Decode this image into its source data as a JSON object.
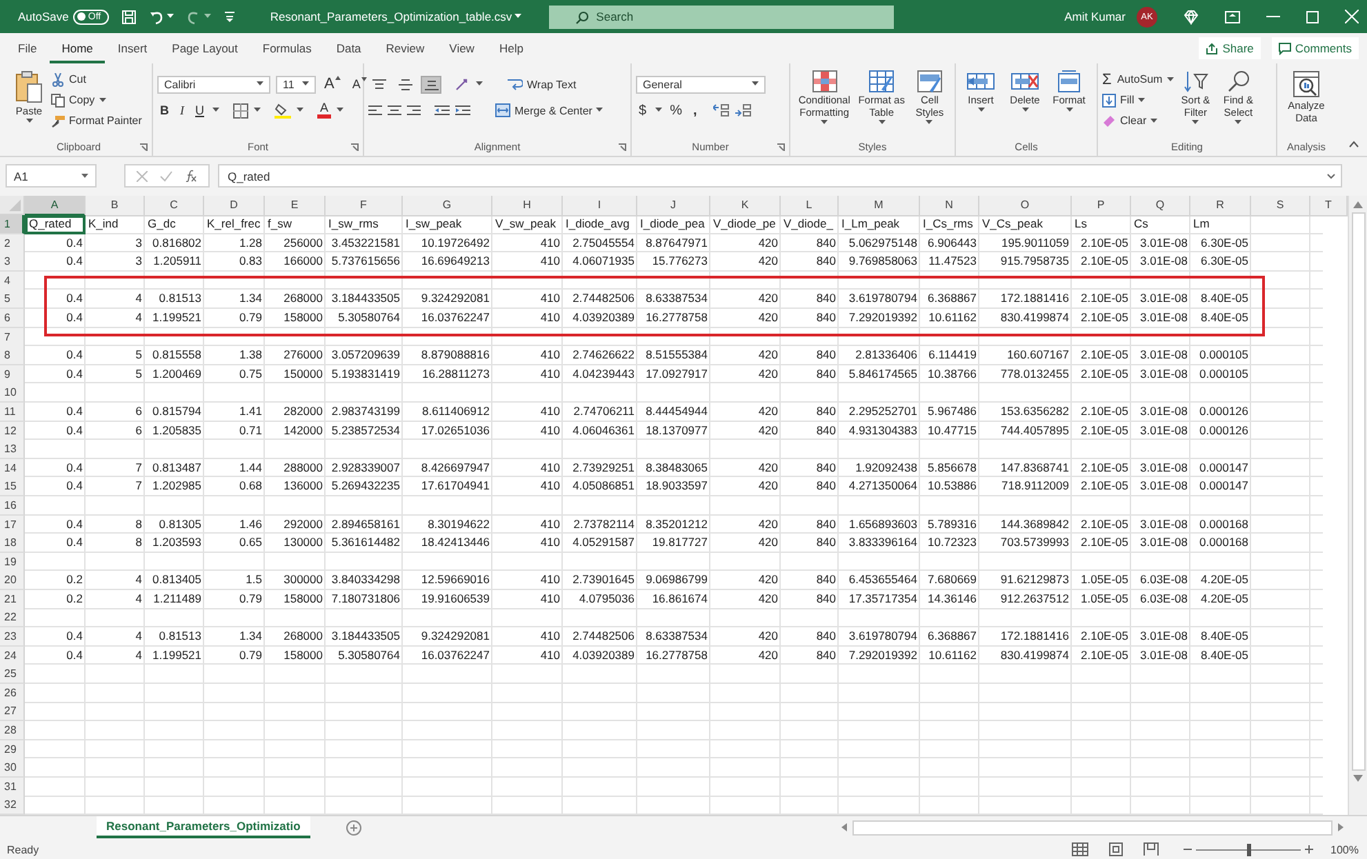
{
  "title_bar": {
    "autosave_label": "AutoSave",
    "autosave_state": "Off",
    "autosave_on": false,
    "file_name": "Resonant_Parameters_Optimization_table.csv",
    "search_placeholder": "Search",
    "user_name": "Amit Kumar",
    "user_initials": "AK"
  },
  "menu_tabs": [
    {
      "label": "File",
      "selected": false
    },
    {
      "label": "Home",
      "selected": true
    },
    {
      "label": "Insert",
      "selected": false
    },
    {
      "label": "Page Layout",
      "selected": false
    },
    {
      "label": "Formulas",
      "selected": false
    },
    {
      "label": "Data",
      "selected": false
    },
    {
      "label": "Review",
      "selected": false
    },
    {
      "label": "View",
      "selected": false
    },
    {
      "label": "Help",
      "selected": false
    }
  ],
  "share": "Share",
  "comments": "Comments",
  "ribbon": {
    "clipboard": {
      "label": "Clipboard",
      "paste": "Paste",
      "cut": "Cut",
      "copy": "Copy",
      "format_painter": "Format Painter"
    },
    "font": {
      "label": "Font",
      "font_name": "Calibri",
      "font_size": "11",
      "grow": "A",
      "shrink": "A",
      "bold": "B",
      "italic": "I",
      "underline": "U",
      "font_color_letter": "A"
    },
    "alignment": {
      "label": "Alignment",
      "vertical": [
        {
          "selected": false
        },
        {
          "selected": false
        },
        {
          "selected": true
        }
      ],
      "wrap_text": "Wrap Text",
      "merge_center": "Merge & Center"
    },
    "number": {
      "label": "Number",
      "format": "General",
      "currency": "$",
      "percent": "%",
      "comma": ","
    },
    "styles": {
      "label": "Styles",
      "conditional_formatting": "Conditional Formatting",
      "format_as_table": "Format as Table",
      "cell_styles": "Cell Styles"
    },
    "cells": {
      "label": "Cells",
      "insert": "Insert",
      "delete": "Delete",
      "format": "Format"
    },
    "editing": {
      "label": "Editing",
      "sum_symbol": "Σ",
      "autosum": "AutoSum",
      "fill": "Fill",
      "clear": "Clear",
      "sort_filter": "Sort & Filter",
      "find_select": "Find & Select"
    },
    "analysis": {
      "label": "Analysis",
      "analyze_data": "Analyze Data"
    }
  },
  "formula_bar": {
    "name_box": "A1",
    "formula": "Q_rated"
  },
  "sheet": {
    "columns": [
      {
        "letter": "A",
        "selected": true
      },
      {
        "letter": "B",
        "selected": false
      },
      {
        "letter": "C",
        "selected": false
      },
      {
        "letter": "D",
        "selected": false
      },
      {
        "letter": "E",
        "selected": false
      },
      {
        "letter": "F",
        "selected": false
      },
      {
        "letter": "G",
        "selected": false
      },
      {
        "letter": "H",
        "selected": false
      },
      {
        "letter": "I",
        "selected": false
      },
      {
        "letter": "J",
        "selected": false
      },
      {
        "letter": "K",
        "selected": false
      },
      {
        "letter": "L",
        "selected": false
      },
      {
        "letter": "M",
        "selected": false
      },
      {
        "letter": "N",
        "selected": false
      },
      {
        "letter": "O",
        "selected": false
      },
      {
        "letter": "P",
        "selected": false
      },
      {
        "letter": "Q",
        "selected": false
      },
      {
        "letter": "R",
        "selected": false
      },
      {
        "letter": "S",
        "selected": false
      },
      {
        "letter": "T",
        "selected": false
      }
    ],
    "header_row": {
      "number": "1",
      "selected": true,
      "cells": [
        "Q_rated",
        "K_ind",
        "G_dc",
        "K_rel_frec",
        "f_sw",
        "I_sw_rms",
        "I_sw_peak",
        "V_sw_peak",
        "I_diode_avg",
        "I_diode_pea",
        "V_diode_pe",
        "V_diode_",
        "I_Lm_peak",
        "I_Cs_rms",
        "V_Cs_peak",
        "Ls",
        "Cs",
        "Lm"
      ]
    },
    "rows": [
      {
        "number": "2",
        "selected": false,
        "cells": [
          "0.4",
          "3",
          "0.816802",
          "1.28",
          "256000",
          "3.453221581",
          "10.19726492",
          "410",
          "2.75045554",
          "8.87647971",
          "420",
          "840",
          "5.062975148",
          "6.906443",
          "195.9011059",
          "2.10E-05",
          "3.01E-08",
          "6.30E-05"
        ]
      },
      {
        "number": "3",
        "selected": false,
        "cells": [
          "0.4",
          "3",
          "1.205911",
          "0.83",
          "166000",
          "5.737615656",
          "16.69649213",
          "410",
          "4.06071935",
          "15.776273",
          "420",
          "840",
          "9.769858063",
          "11.47523",
          "915.7958735",
          "2.10E-05",
          "3.01E-08",
          "6.30E-05"
        ]
      },
      {
        "number": "4",
        "selected": false
      },
      {
        "number": "5",
        "selected": false,
        "cells": [
          "0.4",
          "4",
          "0.81513",
          "1.34",
          "268000",
          "3.184433505",
          "9.324292081",
          "410",
          "2.74482506",
          "8.63387534",
          "420",
          "840",
          "3.619780794",
          "6.368867",
          "172.1881416",
          "2.10E-05",
          "3.01E-08",
          "8.40E-05"
        ]
      },
      {
        "number": "6",
        "selected": false,
        "cells": [
          "0.4",
          "4",
          "1.199521",
          "0.79",
          "158000",
          "5.30580764",
          "16.03762247",
          "410",
          "4.03920389",
          "16.2778758",
          "420",
          "840",
          "7.292019392",
          "10.61162",
          "830.4199874",
          "2.10E-05",
          "3.01E-08",
          "8.40E-05"
        ]
      },
      {
        "number": "7",
        "selected": false
      },
      {
        "number": "8",
        "selected": false,
        "cells": [
          "0.4",
          "5",
          "0.815558",
          "1.38",
          "276000",
          "3.057209639",
          "8.879088816",
          "410",
          "2.74626622",
          "8.51555384",
          "420",
          "840",
          "2.81336406",
          "6.114419",
          "160.607167",
          "2.10E-05",
          "3.01E-08",
          "0.000105"
        ]
      },
      {
        "number": "9",
        "selected": false,
        "cells": [
          "0.4",
          "5",
          "1.200469",
          "0.75",
          "150000",
          "5.193831419",
          "16.28811273",
          "410",
          "4.04239443",
          "17.0927917",
          "420",
          "840",
          "5.846174565",
          "10.38766",
          "778.0132455",
          "2.10E-05",
          "3.01E-08",
          "0.000105"
        ]
      },
      {
        "number": "10",
        "selected": false
      },
      {
        "number": "11",
        "selected": false,
        "cells": [
          "0.4",
          "6",
          "0.815794",
          "1.41",
          "282000",
          "2.983743199",
          "8.611406912",
          "410",
          "2.74706211",
          "8.44454944",
          "420",
          "840",
          "2.295252701",
          "5.967486",
          "153.6356282",
          "2.10E-05",
          "3.01E-08",
          "0.000126"
        ]
      },
      {
        "number": "12",
        "selected": false,
        "cells": [
          "0.4",
          "6",
          "1.205835",
          "0.71",
          "142000",
          "5.238572534",
          "17.02651036",
          "410",
          "4.06046361",
          "18.1370977",
          "420",
          "840",
          "4.931304383",
          "10.47715",
          "744.4057895",
          "2.10E-05",
          "3.01E-08",
          "0.000126"
        ]
      },
      {
        "number": "13",
        "selected": false
      },
      {
        "number": "14",
        "selected": false,
        "cells": [
          "0.4",
          "7",
          "0.813487",
          "1.44",
          "288000",
          "2.928339007",
          "8.426697947",
          "410",
          "2.73929251",
          "8.38483065",
          "420",
          "840",
          "1.92092438",
          "5.856678",
          "147.8368741",
          "2.10E-05",
          "3.01E-08",
          "0.000147"
        ]
      },
      {
        "number": "15",
        "selected": false,
        "cells": [
          "0.4",
          "7",
          "1.202985",
          "0.68",
          "136000",
          "5.269432235",
          "17.61704941",
          "410",
          "4.05086851",
          "18.9033597",
          "420",
          "840",
          "4.271350064",
          "10.53886",
          "718.9112009",
          "2.10E-05",
          "3.01E-08",
          "0.000147"
        ]
      },
      {
        "number": "16",
        "selected": false
      },
      {
        "number": "17",
        "selected": false,
        "cells": [
          "0.4",
          "8",
          "0.81305",
          "1.46",
          "292000",
          "2.894658161",
          "8.30194622",
          "410",
          "2.73782114",
          "8.35201212",
          "420",
          "840",
          "1.656893603",
          "5.789316",
          "144.3689842",
          "2.10E-05",
          "3.01E-08",
          "0.000168"
        ]
      },
      {
        "number": "18",
        "selected": false,
        "cells": [
          "0.4",
          "8",
          "1.203593",
          "0.65",
          "130000",
          "5.361614482",
          "18.42413446",
          "410",
          "4.05291587",
          "19.817727",
          "420",
          "840",
          "3.833396164",
          "10.72323",
          "703.5739993",
          "2.10E-05",
          "3.01E-08",
          "0.000168"
        ]
      },
      {
        "number": "19",
        "selected": false
      },
      {
        "number": "20",
        "selected": false,
        "cells": [
          "0.2",
          "4",
          "0.813405",
          "1.5",
          "300000",
          "3.840334298",
          "12.59669016",
          "410",
          "2.73901645",
          "9.06986799",
          "420",
          "840",
          "6.453655464",
          "7.680669",
          "91.62129873",
          "1.05E-05",
          "6.03E-08",
          "4.20E-05"
        ]
      },
      {
        "number": "21",
        "selected": false,
        "cells": [
          "0.2",
          "4",
          "1.211489",
          "0.79",
          "158000",
          "7.180731806",
          "19.91606539",
          "410",
          "4.0795036",
          "16.861674",
          "420",
          "840",
          "17.35717354",
          "14.36146",
          "912.2637512",
          "1.05E-05",
          "6.03E-08",
          "4.20E-05"
        ]
      },
      {
        "number": "22",
        "selected": false
      },
      {
        "number": "23",
        "selected": false,
        "cells": [
          "0.4",
          "4",
          "0.81513",
          "1.34",
          "268000",
          "3.184433505",
          "9.324292081",
          "410",
          "2.74482506",
          "8.63387534",
          "420",
          "840",
          "3.619780794",
          "6.368867",
          "172.1881416",
          "2.10E-05",
          "3.01E-08",
          "8.40E-05"
        ]
      },
      {
        "number": "24",
        "selected": false,
        "cells": [
          "0.4",
          "4",
          "1.199521",
          "0.79",
          "158000",
          "5.30580764",
          "16.03762247",
          "410",
          "4.03920389",
          "16.2778758",
          "420",
          "840",
          "7.292019392",
          "10.61162",
          "830.4199874",
          "2.10E-05",
          "3.01E-08",
          "8.40E-05"
        ]
      },
      {
        "number": "25",
        "selected": false
      },
      {
        "number": "26",
        "selected": false
      },
      {
        "number": "27",
        "selected": false
      },
      {
        "number": "28",
        "selected": false
      },
      {
        "number": "29",
        "selected": false
      },
      {
        "number": "30",
        "selected": false
      },
      {
        "number": "31",
        "selected": false
      },
      {
        "number": "32",
        "selected": false
      }
    ]
  },
  "sheet_tabs": [
    {
      "label": "Resonant_Parameters_Optimizatio",
      "selected": true
    }
  ],
  "status_bar": {
    "status": "Ready",
    "zoom": "100%",
    "zoom_slider": {
      "level": 0.5
    }
  }
}
